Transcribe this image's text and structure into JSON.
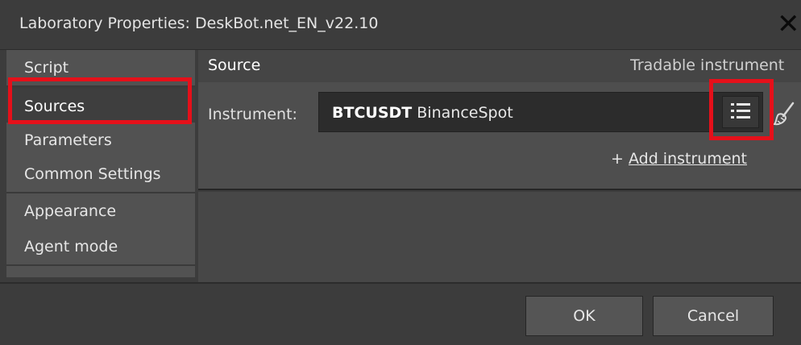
{
  "window": {
    "title": "Laboratory Properties: DeskBot.net_EN_v22.10",
    "close_icon": "close-icon"
  },
  "sidebar": {
    "items": [
      {
        "label": "Script"
      },
      {
        "label": "Sources",
        "selected": true
      },
      {
        "label": "Parameters"
      },
      {
        "label": "Common Settings"
      },
      {
        "label": "Appearance"
      },
      {
        "label": "Agent mode"
      }
    ]
  },
  "content": {
    "heading": "Source",
    "tradable_label": "Tradable instrument",
    "instrument_label": "Instrument:",
    "instrument_symbol": "BTCUSDT",
    "instrument_exchange": " BinanceSpot",
    "list_icon": "list-icon",
    "clear_icon": "brush-icon",
    "add_prefix": "+ ",
    "add_link": "Add instrument"
  },
  "footer": {
    "ok_label": "OK",
    "cancel_label": "Cancel"
  },
  "colors": {
    "highlight": "#e5101a",
    "background": "#3c3c3c"
  }
}
